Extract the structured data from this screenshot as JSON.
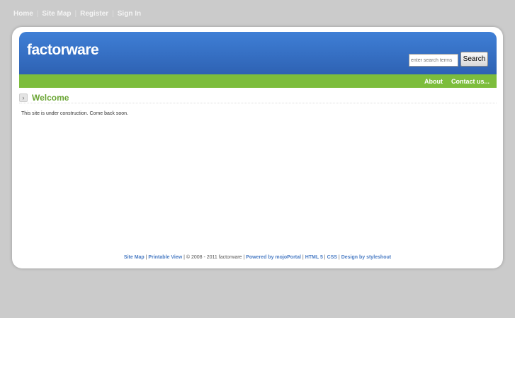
{
  "topnav": [
    "Home",
    "Site Map",
    "Register",
    "Sign In"
  ],
  "logo": "factorware",
  "search": {
    "placeholder": "enter search terms",
    "button": "Search"
  },
  "menu": [
    "About",
    "Contact us..."
  ],
  "page_title": "Welcome",
  "content": "This site is under construction. Come back soon.",
  "footer": {
    "site_map": "Site Map",
    "printable": "Printable View",
    "copyright": "© 2008 - 2011 factorware",
    "powered": "Powered by mojoPortal",
    "html5": "HTML 5",
    "css": "CSS",
    "design": "Design by styleshout",
    "sep": " | "
  }
}
